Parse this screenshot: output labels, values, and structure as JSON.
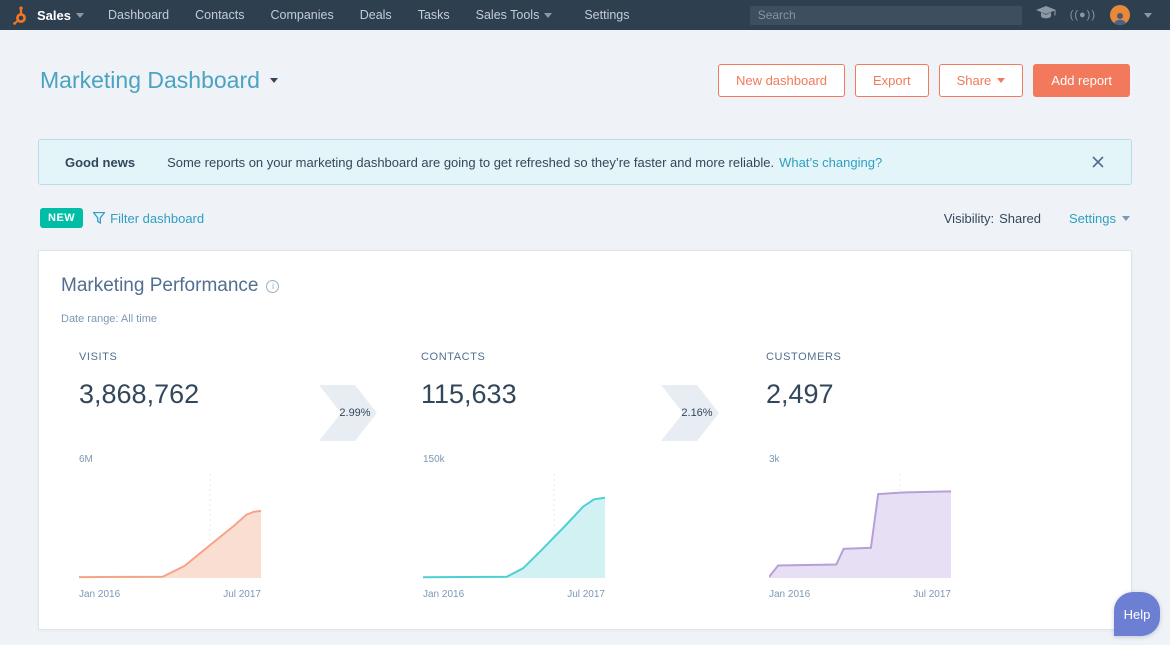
{
  "colors": {
    "accent": "#f2795c",
    "link_teal": "#2f9fc1",
    "badge_green": "#00bda5",
    "nav_bg": "#2e3f50",
    "title_teal": "#4aa3c1",
    "dark_text": "#33475b"
  },
  "navbar": {
    "product": "Sales",
    "items": [
      {
        "label": "Dashboard",
        "caret": false
      },
      {
        "label": "Contacts",
        "caret": false
      },
      {
        "label": "Companies",
        "caret": false
      },
      {
        "label": "Deals",
        "caret": false
      },
      {
        "label": "Tasks",
        "caret": false
      },
      {
        "label": "Sales Tools",
        "caret": true
      },
      {
        "label": "Settings",
        "caret": false
      }
    ],
    "search_placeholder": "Search"
  },
  "header": {
    "title": "Marketing Dashboard",
    "buttons": {
      "new_dashboard": "New dashboard",
      "export": "Export",
      "share": "Share",
      "add_report": "Add report"
    }
  },
  "banner": {
    "title": "Good news",
    "message": "Some reports on your marketing dashboard are going to get refreshed so they’re faster and more reliable.",
    "link": "What’s changing?"
  },
  "toolbar": {
    "new_badge": "NEW",
    "filter": "Filter dashboard",
    "visibility_label": "Visibility:",
    "visibility_value": "Shared",
    "settings": "Settings"
  },
  "report": {
    "title": "Marketing Performance",
    "date_range": "Date range: All time",
    "metrics": [
      {
        "label": "VISITS",
        "value": "3,868,762"
      },
      {
        "label": "CONTACTS",
        "value": "115,633"
      },
      {
        "label": "CUSTOMERS",
        "value": "2,497"
      }
    ],
    "conversions": [
      "2.99%",
      "2.16%"
    ]
  },
  "chart_data": [
    {
      "type": "area",
      "title": "VISITS",
      "ymax": 6000000,
      "ymax_label": "6M",
      "x_ticks": [
        "Jan 2016",
        "Jul 2017"
      ],
      "line_color": "#f6a488",
      "fill_color": "#fbded2",
      "points": [
        [
          0,
          50000
        ],
        [
          0.46,
          70000
        ],
        [
          0.58,
          700000
        ],
        [
          0.72,
          1900000
        ],
        [
          0.85,
          3000000
        ],
        [
          0.92,
          3650000
        ],
        [
          0.96,
          3820000
        ],
        [
          1,
          3868762
        ]
      ]
    },
    {
      "type": "area",
      "title": "CONTACTS",
      "ymax": 150000,
      "ymax_label": "150k",
      "x_ticks": [
        "Jan 2016",
        "Jul 2017"
      ],
      "line_color": "#4ecfd6",
      "fill_color": "#d2f1f3",
      "points": [
        [
          0,
          1200
        ],
        [
          0.46,
          1800
        ],
        [
          0.55,
          14000
        ],
        [
          0.65,
          40000
        ],
        [
          0.78,
          75000
        ],
        [
          0.88,
          103000
        ],
        [
          0.94,
          113500
        ],
        [
          1,
          115633
        ]
      ]
    },
    {
      "type": "area",
      "title": "CUSTOMERS",
      "ymax": 3000,
      "ymax_label": "3k",
      "x_ticks": [
        "Jan 2016",
        "Jul 2017"
      ],
      "line_color": "#b79fd8",
      "fill_color": "#e7e0f4",
      "points": [
        [
          0,
          30
        ],
        [
          0.05,
          360
        ],
        [
          0.37,
          390
        ],
        [
          0.41,
          840
        ],
        [
          0.56,
          870
        ],
        [
          0.6,
          2420
        ],
        [
          0.75,
          2470
        ],
        [
          1,
          2497
        ]
      ]
    }
  ],
  "help": {
    "label": "Help"
  }
}
